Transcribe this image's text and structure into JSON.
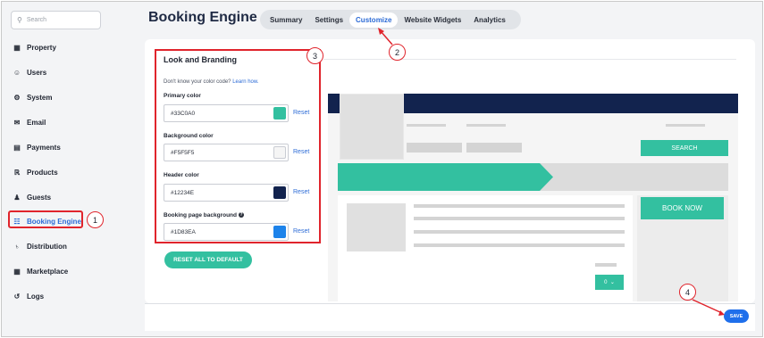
{
  "sidebar": {
    "search_placeholder": "Search",
    "items": [
      {
        "label": "Property",
        "icon": "building-icon"
      },
      {
        "label": "Users",
        "icon": "user-circle-icon"
      },
      {
        "label": "System",
        "icon": "gear-icon"
      },
      {
        "label": "Email",
        "icon": "envelope-icon"
      },
      {
        "label": "Payments",
        "icon": "credit-card-icon"
      },
      {
        "label": "Products",
        "icon": "cart-icon"
      },
      {
        "label": "Guests",
        "icon": "person-icon"
      },
      {
        "label": "Booking Engine",
        "icon": "calendar-icon",
        "active": true
      },
      {
        "label": "Distribution",
        "icon": "network-icon"
      },
      {
        "label": "Marketplace",
        "icon": "apps-icon"
      },
      {
        "label": "Logs",
        "icon": "history-icon"
      }
    ]
  },
  "header": {
    "title": "Booking Engine",
    "tabs": [
      {
        "label": "Summary"
      },
      {
        "label": "Settings"
      },
      {
        "label": "Customize",
        "active": true
      },
      {
        "label": "Website Widgets"
      },
      {
        "label": "Analytics"
      }
    ]
  },
  "branding": {
    "title": "Look and Branding",
    "help_text": "Don't know your color code?",
    "help_link": "Learn how.",
    "reset_label": "Reset",
    "fields": [
      {
        "label": "Primary color",
        "value": "#33C0A0",
        "color": "#33C0A0"
      },
      {
        "label": "Background color",
        "value": "#F5F5F5",
        "color": "#F5F5F5"
      },
      {
        "label": "Header color",
        "value": "#12234E",
        "color": "#12234E"
      },
      {
        "label": "Booking page background",
        "value": "#1D83EA",
        "color": "#1D83EA"
      }
    ],
    "reset_all_label": "RESET ALL TO DEFAULT"
  },
  "preview": {
    "search_label": "SEARCH",
    "book_now_label": "BOOK NOW",
    "qty_value": "0"
  },
  "footer": {
    "save_label": "SAVE"
  },
  "callouts": [
    "1",
    "2",
    "3",
    "4"
  ]
}
